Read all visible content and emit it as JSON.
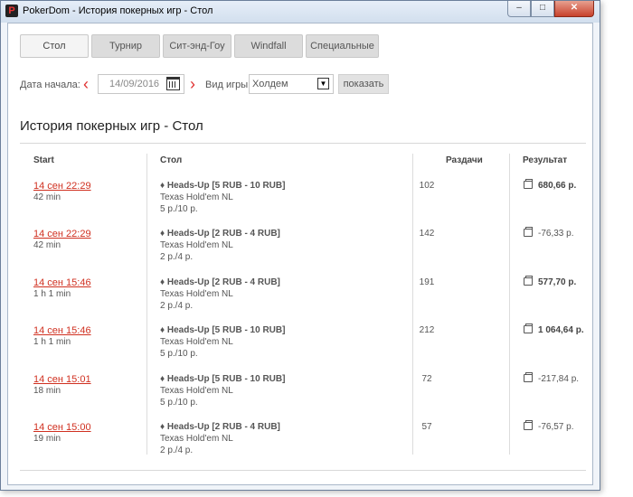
{
  "window": {
    "title": "PokerDom - История покерных игр - Стол",
    "minimize": "–",
    "maximize": "□",
    "close": "✕"
  },
  "tabs": [
    {
      "label": "Стол",
      "active": true
    },
    {
      "label": "Турнир",
      "active": false
    },
    {
      "label": "Сит-энд-Гоу",
      "active": false
    },
    {
      "label": "Windfall",
      "active": false
    },
    {
      "label": "Специальные",
      "active": false
    }
  ],
  "filter": {
    "start_date_label": "Дата начала:",
    "prev_arrow": "‹",
    "next_arrow": "›",
    "date_value": "14/09/2016",
    "game_type_label": "Вид игры:",
    "game_type_value": "Холдем",
    "show_button": "показать"
  },
  "heading": "История покерных игр - Стол",
  "columns": {
    "start": "Start",
    "table": "Стол",
    "hands": "Раздачи",
    "result": "Результат"
  },
  "rows": [
    {
      "date": "14 сен 22:29",
      "duration": "42 min",
      "table": "♦ Heads-Up [5 RUB - 10 RUB]",
      "game": "Texas Hold'em NL",
      "stakes": "5 р./10 р.",
      "hands": "102",
      "result": "680,66 р."
    },
    {
      "date": "14 сен 22:29",
      "duration": "42 min",
      "table": "♦ Heads-Up [2 RUB - 4 RUB]",
      "game": "Texas Hold'em NL",
      "stakes": "2 р./4 р.",
      "hands": "142",
      "result": "-76,33 р."
    },
    {
      "date": "14 сен 15:46",
      "duration": "1 h 1 min",
      "table": "♦ Heads-Up [2 RUB - 4 RUB]",
      "game": "Texas Hold'em NL",
      "stakes": "2 р./4 р.",
      "hands": "191",
      "result": "577,70 р."
    },
    {
      "date": "14 сен 15:46",
      "duration": "1 h 1 min",
      "table": "♦ Heads-Up [5 RUB - 10 RUB]",
      "game": "Texas Hold'em NL",
      "stakes": "5 р./10 р.",
      "hands": "212",
      "result": "1 064,64 р."
    },
    {
      "date": "14 сен 15:01",
      "duration": "18 min",
      "table": "♦ Heads-Up [5 RUB - 10 RUB]",
      "game": "Texas Hold'em NL",
      "stakes": "5 р./10 р.",
      "hands": "72",
      "result": "-217,84 р."
    },
    {
      "date": "14 сен 15:00",
      "duration": "19 min",
      "table": "♦ Heads-Up [2 RUB - 4 RUB]",
      "game": "Texas Hold'em NL",
      "stakes": "2 р./4 р.",
      "hands": "57",
      "result": "-76,57 р."
    }
  ]
}
